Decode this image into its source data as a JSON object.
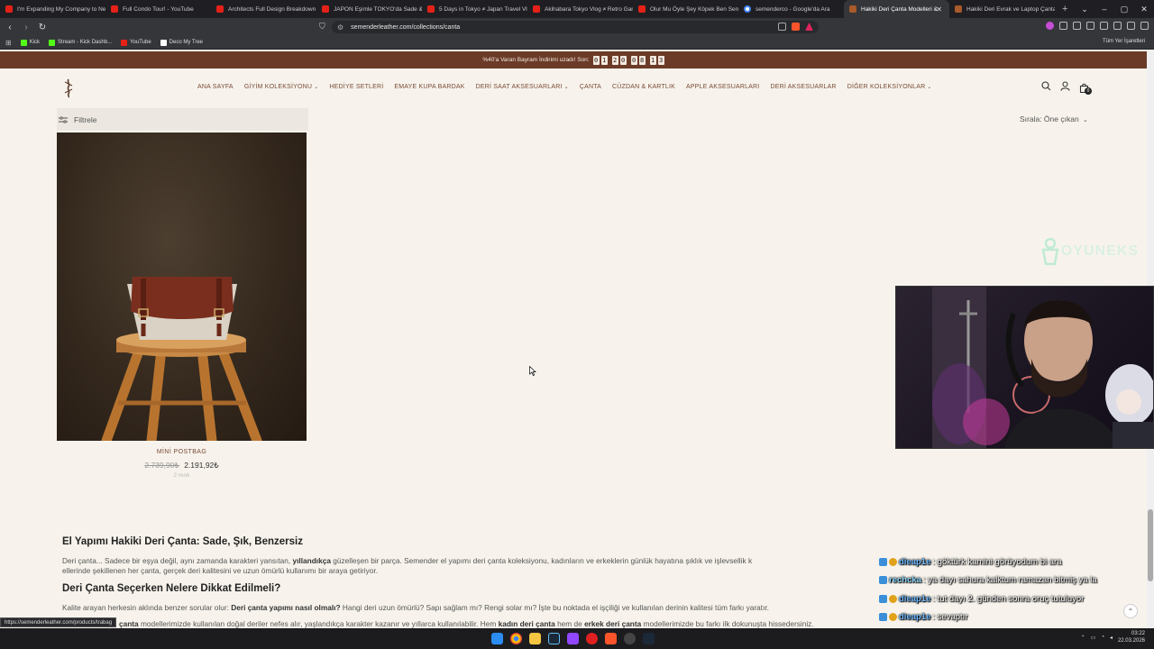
{
  "browser": {
    "tabs": [
      {
        "title": "I'm Expanding My Company to Ne",
        "icon": "youtube-icon"
      },
      {
        "title": "Full Condo Tour! - YouTube",
        "icon": "youtube-icon"
      },
      {
        "title": "Architects Full Design Breakdown",
        "icon": "youtube-icon"
      },
      {
        "title": "JAPON Eşimle TOKYO'da Sade & H",
        "icon": "youtube-icon"
      },
      {
        "title": "5 Days in Tokyo ≠ Japan Travel Vl",
        "icon": "youtube-icon"
      },
      {
        "title": "Akihabara Tokyo Vlog ≠ Retro Gar",
        "icon": "youtube-icon"
      },
      {
        "title": "Olur Mu Öyle Şey Köpek Ben Senin",
        "icon": "youtube-icon"
      },
      {
        "title": "semenderco - Google'da Ara",
        "icon": "google-icon"
      },
      {
        "title": "Hakiki Deri Çanta Modelleri &",
        "icon": "site-icon",
        "active": true
      },
      {
        "title": "Hakiki Deri Evrak ve Laptop Çanta",
        "icon": "site-icon"
      }
    ],
    "url": "semenderleather.com/collections/canta",
    "bookmarks": [
      {
        "label": "Kick",
        "color": "#53fc18"
      },
      {
        "label": "Stream - Kick Dashb...",
        "color": "#53fc18"
      },
      {
        "label": "YouTube",
        "color": "#e62117"
      },
      {
        "label": "Deco My Tree",
        "color": "#ffffff"
      }
    ],
    "all_bookmarks": "Tüm Yer İşaretleri",
    "status_url": "https://semenderleather.com/products/trabag"
  },
  "announcement": {
    "text": "%40'a Varan Bayram İndirimi uzadı! Son:",
    "countdown": [
      "0",
      "1",
      "2",
      "0",
      "0",
      "8",
      "1",
      "3"
    ]
  },
  "nav": {
    "items": [
      {
        "label": "ANA SAYFA",
        "dropdown": false
      },
      {
        "label": "GİYİM KOLEKSİYONU",
        "dropdown": true
      },
      {
        "label": "HEDİYE SETLERİ",
        "dropdown": false
      },
      {
        "label": "EMAYE KUPA BARDAK",
        "dropdown": false
      },
      {
        "label": "DERİ SAAT AKSESUARLARI",
        "dropdown": true
      },
      {
        "label": "ÇANTA",
        "dropdown": false
      },
      {
        "label": "CÜZDAN & KARTLIK",
        "dropdown": false
      },
      {
        "label": "APPLE AKSESUARLARI",
        "dropdown": false
      },
      {
        "label": "DERİ AKSESUARLAR",
        "dropdown": false
      },
      {
        "label": "DİĞER KOLEKSİYONLAR",
        "dropdown": true
      }
    ],
    "cart_count": "0"
  },
  "toolbar": {
    "filter_label": "Filtrele",
    "sort_label": "Sırala: Öne çıkan"
  },
  "product": {
    "name": "MİNİ POSTBAG",
    "old_price": "2.739,90₺",
    "price": "2.191,92₺",
    "colors": "2 renk"
  },
  "description": {
    "heading1": "El Yapımı Hakiki Deri Çanta: Sade, Şık, Benzersiz",
    "p1a": "Deri çanta... Sadece bir eşya değil, aynı zamanda karakteri yansıtan, ",
    "p1b": "yıllandıkça",
    "p1c": " güzelleşen bir parça. Semender el yapımı deri çanta koleksiyonu, kadınların ve erkeklerin günlük hayatına şıklık ve işlevsellik k",
    "p1d": "ellerinde şekillenen her çanta, gerçek deri kalitesini ve uzun ömürlü kullanımı bir araya getiriyor.",
    "heading2": "Deri Çanta Seçerken Nelere Dikkat Edilmeli?",
    "p2a": "Kalite arayan herkesin aklında benzer sorular olur: ",
    "p2b": "Deri çanta yapımı nasıl olmalı?",
    "p2c": " Hangi deri uzun ömürlü? Sapı sağlam mı? Rengi solar mı? İşte bu noktada el işçiliği ve kullanılan derinin kalitesi tüm farkı yaratır.",
    "p3a": "çanta",
    "p3b": " modellerimizde kullanılan doğal deriler nefes alır, yaşlandıkça karakter kazanır ve yıllarca kullanılabilir. Hem ",
    "p3c": "kadın deri çanta",
    "p3d": " hem de ",
    "p3e": "erkek deri çanta",
    "p3f": " modellerimizde bu farkı ilk dokunuşta hissedersiniz."
  },
  "stream_overlay": {
    "watermark": "OYUNEKS",
    "chat": [
      {
        "user": "dieap1e",
        "message": ": göktürk kamini görüyodum bi ara"
      },
      {
        "user": "rechcka",
        "message": ": ya dayı sahura kalktum ramazan bitmiş ya la"
      },
      {
        "user": "dieap1e",
        "message": ": tut dayı 2. günden sonra oruç tutuluyor"
      },
      {
        "user": "dieap1e",
        "message": ": sevaptır"
      }
    ]
  },
  "taskbar": {
    "time": "03:22",
    "date": "22.03.2026"
  }
}
